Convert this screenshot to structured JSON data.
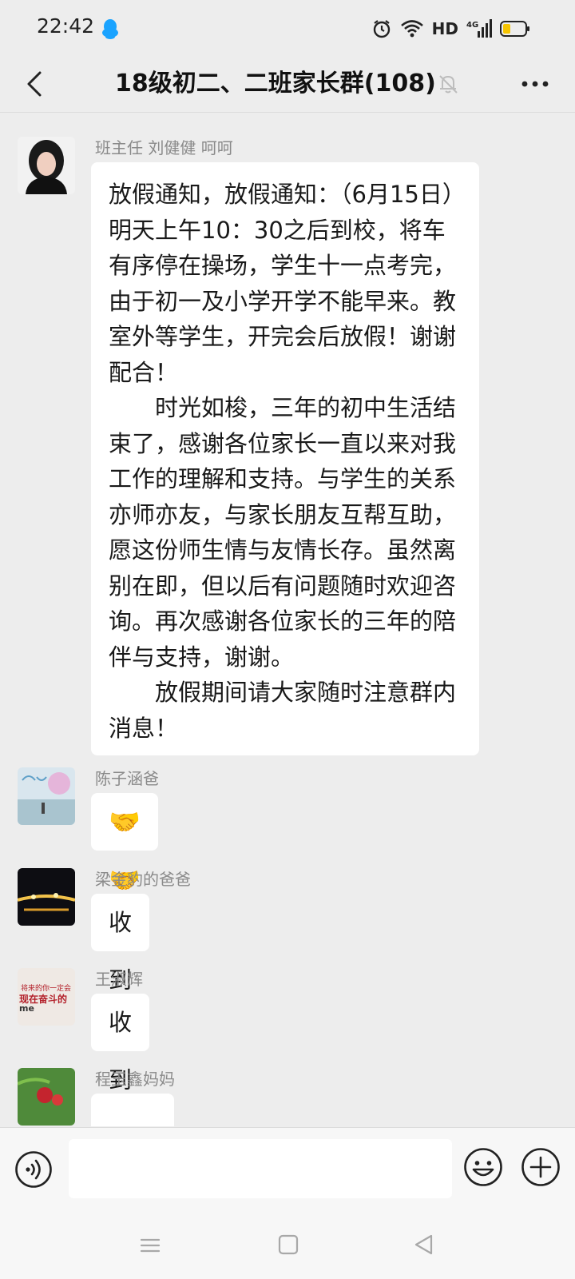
{
  "status_bar": {
    "time": "22:42",
    "network": "HD",
    "signal_label": "4G"
  },
  "header": {
    "title": "18级初二、二班家长群(108)"
  },
  "messages": [
    {
      "sender": "班主任 刘健健 呵呵",
      "paragraphs": [
        "放假通知，放假通知：（6月15日）明天上午10：30之后到校，将车有序停在操场，学生十一点考完，由于初一及小学开学不能早来。教室外等学生，开完会后放假！谢谢配合！",
        "时光如梭，三年的初中生活结束了，感谢各位家长一直以来对我工作的理解和支持。与学生的关系亦师亦友，与家长朋友互帮互助，愿这份师生情与友情长存。虽然离别在即，但以后有问题随时欢迎咨询。再次感谢各位家长的三年的陪伴与支持，谢谢。",
        "放假期间请大家随时注意群内消息！"
      ]
    },
    {
      "sender": "陈子涵爸",
      "text": "🤝🤝🤝"
    },
    {
      "sender": "梁金豹的爸爸",
      "text": "收到"
    },
    {
      "sender": "王淑辉",
      "text": "收到"
    },
    {
      "sender": "程玉鑫妈妈",
      "text": ""
    }
  ],
  "avatar_texts": {
    "m4_line1": "将来的你一定会",
    "m4_line2": "现在奋斗的",
    "m4_line3": "me"
  },
  "input": {
    "placeholder": ""
  },
  "colors": {
    "background": "#ededed",
    "bubble": "#ffffff",
    "sender": "#8a8a8a",
    "battery": "#f5c400"
  }
}
